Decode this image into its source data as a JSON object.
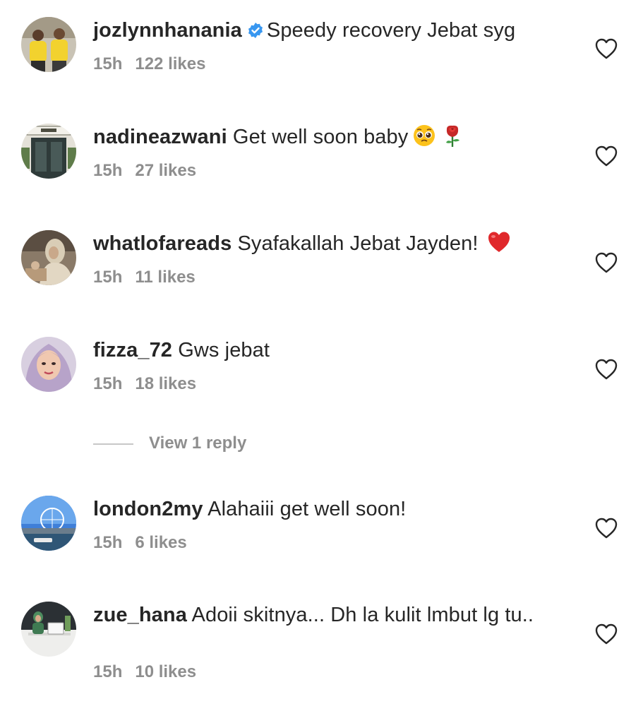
{
  "comments": [
    {
      "username": "jozlynnhanania",
      "verified": true,
      "text": "Speedy recovery Jebat syg",
      "emoji": [],
      "time": "15h",
      "likes": "122 likes",
      "avatar": "avatar-two-people-yellow-shirts"
    },
    {
      "username": "nadineazwani",
      "verified": false,
      "text": "Get well soon baby",
      "emoji": [
        "pleading-face-emoji",
        "rose-emoji"
      ],
      "time": "15h",
      "likes": "27 likes",
      "avatar": "avatar-storefront"
    },
    {
      "username": "whatlofareads",
      "verified": false,
      "text": "Syafakallah Jebat Jayden!",
      "emoji": [
        "red-heart-emoji"
      ],
      "time": "15h",
      "likes": "11 likes",
      "avatar": "avatar-woman-hijab-cafe"
    },
    {
      "username": "fizza_72",
      "verified": false,
      "text": "Gws jebat",
      "emoji": [],
      "time": "15h",
      "likes": "18 likes",
      "avatar": "avatar-woman-hijab-portrait"
    },
    {
      "username": "london2my",
      "verified": false,
      "text": "Alahaiii get well soon!",
      "emoji": [],
      "time": "15h",
      "likes": "6 likes",
      "avatar": "avatar-london-eye"
    },
    {
      "username": "zue_hana",
      "verified": false,
      "text": "Adoii skitnya... Dh la kulit lmbut lg tu..",
      "emoji": [],
      "time": "15h",
      "likes": "10 likes",
      "avatar": "avatar-woman-at-desk"
    }
  ],
  "view_replies": {
    "label": "View 1 reply"
  },
  "colors": {
    "text": "#262626",
    "meta": "#8e8e8e",
    "verified_badge": "#3897f0",
    "heart_outline": "#262626",
    "divider_line": "#c7c7c7"
  }
}
